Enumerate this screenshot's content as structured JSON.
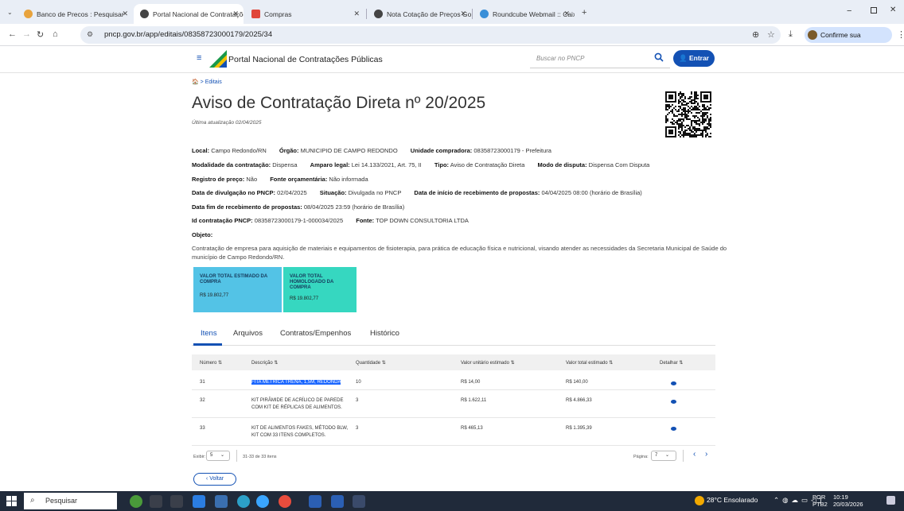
{
  "browser": {
    "tabs": [
      {
        "label": "Banco de Precos : Pesquisar",
        "color": "#e8a33d"
      },
      {
        "label": "Portal Nacional de Contrataçõe",
        "color": "#444444"
      },
      {
        "label": "Compras",
        "color": "#e0463a"
      },
      {
        "label": "Nota Cotação de Preços Goiouc",
        "color": "#444444"
      },
      {
        "label": "Roundcube Webmail :: Caixa de",
        "color": "#3a8fd8"
      }
    ],
    "url": "pncp.gov.br/app/editais/08358723000179/2025/34",
    "identity": "Confirme sua identidade"
  },
  "header": {
    "brand": "Portal Nacional de Contratações Públicas",
    "search_placeholder": "Buscar no PNCP",
    "login": "Entrar"
  },
  "breadcrumb": {
    "home": "Editais"
  },
  "title": "Aviso de Contratação Direta nº 20/2025",
  "updated": "Última atualização 02/04/2025",
  "info": {
    "local_l": "Local:",
    "local_v": "Campo Redondo/RN",
    "orgao_l": "Órgão:",
    "orgao_v": "MUNICIPIO DE CAMPO REDONDO",
    "unidade_l": "Unidade compradora:",
    "unidade_v": "08358723000179 - Prefeitura",
    "modalidade_l": "Modalidade da contratação:",
    "modalidade_v": "Dispensa",
    "amparo_l": "Amparo legal:",
    "amparo_v": "Lei 14.133/2021, Art. 75, II",
    "tipo_l": "Tipo:",
    "tipo_v": "Aviso de Contratação Direta",
    "disputa_l": "Modo de disputa:",
    "disputa_v": "Dispensa Com Disputa",
    "registro_l": "Registro de preço:",
    "registro_v": "Não",
    "fonte_orc_l": "Fonte orçamentária:",
    "fonte_orc_v": "Não informada",
    "divulg_l": "Data de divulgação no PNCP:",
    "divulg_v": "02/04/2025",
    "situacao_l": "Situação:",
    "situacao_v": "Divulgada no PNCP",
    "inicio_l": "Data de início de recebimento de propostas:",
    "inicio_v": "04/04/2025 08:00 (horário de Brasília)",
    "fim_l": "Data fim de recebimento de propostas:",
    "fim_v": "08/04/2025 23:59 (horário de Brasília)",
    "id_l": "Id contratação PNCP:",
    "id_v": "08358723000179-1-000034/2025",
    "fonte_l": "Fonte:",
    "fonte_v": "TOP DOWN CONSULTORIA LTDA",
    "objeto_l": "Objeto:",
    "objeto_v": "Contratação de empresa para aquisição de materiais e equipamentos de fisioterapia, para prática de educação física e nutricional, visando atender as necessidades da Secretaria Municipal de Saúde do município de Campo Redondo/RN."
  },
  "cards": [
    {
      "label": "VALOR TOTAL ESTIMADO DA COMPRA",
      "value": "R$ 19.802,77",
      "color": "#53c3e6"
    },
    {
      "label": "VALOR TOTAL HOMOLOGADO DA COMPRA",
      "value": "R$ 19.802,77",
      "color": "#36d7c0"
    }
  ],
  "page_tabs": [
    "Itens",
    "Arquivos",
    "Contratos/Empenhos",
    "Histórico"
  ],
  "table": {
    "headers": [
      "Número",
      "Descrição",
      "Quantidade",
      "Valor unitário estimado",
      "Valor total estimado",
      "Detalhar"
    ],
    "rows": [
      {
        "num": "31",
        "desc": "FITA MÉTRICA TRENA, 1,5M, REDONDA",
        "qtd": "10",
        "unit": "R$ 14,00",
        "total": "R$ 140,00"
      },
      {
        "num": "32",
        "desc": "KIT PIRÂMIDE DE ACRÍLICO DE PAREDE COM KIT DE RÉPLICAS DE ALIMENTOS.",
        "qtd": "3",
        "unit": "R$ 1.622,11",
        "total": "R$ 4.866,33"
      },
      {
        "num": "33",
        "desc": "KIT DE ALIMENTOS FAKES, MÉTODO BLW, KIT COM 33 ITENS COMPLETOS.",
        "qtd": "3",
        "unit": "R$ 465,13",
        "total": "R$ 1.395,39"
      }
    ]
  },
  "pagination": {
    "exibir": "Exibir:",
    "per_page": "5",
    "range": "31-33 de 33 itens",
    "pagina": "Página:",
    "page": "7"
  },
  "back": "Voltar",
  "taskbar": {
    "search": "Pesquisar",
    "weather": "28°C  Ensolarado",
    "lang1": "POR",
    "lang2": "PTB2",
    "time": "10:19",
    "date": "20/03/2026"
  }
}
